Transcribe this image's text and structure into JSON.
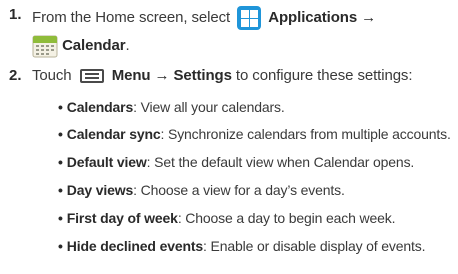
{
  "steps": [
    {
      "number": "1.",
      "text_before": "From the Home screen, select",
      "apps_label": "Applications →",
      "calendar_label": "Calendar",
      "end": "."
    },
    {
      "number": "2.",
      "text_before": "Touch",
      "menu_label": "Menu → Settings",
      "text_after": " to configure these settings:"
    }
  ],
  "settings": [
    {
      "term": "Calendars",
      "desc": ": View all your calendars."
    },
    {
      "term": "Calendar sync",
      "desc": ": Synchronize calendars from multiple accounts."
    },
    {
      "term": "Default view",
      "desc": ": Set the default view when Calendar opens."
    },
    {
      "term": "Day views",
      "desc": ": Choose a view for a day’s events."
    },
    {
      "term": "First day of week",
      "desc": ": Choose a day to begin each week."
    },
    {
      "term": "Hide declined events",
      "desc": ": Enable or disable display of events."
    }
  ],
  "bullet": "•",
  "icons": {
    "applications": "applications-grid-icon",
    "calendar": "calendar-icon",
    "menu": "menu-icon"
  },
  "colors": {
    "applications_icon": "#1f95d9",
    "calendar_icon": "#8fbc3a"
  }
}
